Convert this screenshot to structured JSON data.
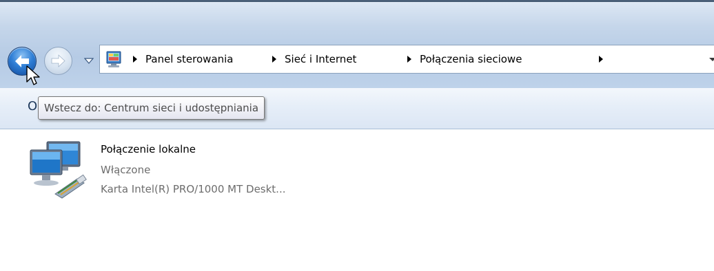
{
  "navigation": {
    "back_icon": "arrow-left-icon",
    "forward_icon": "arrow-right-icon",
    "history_icon": "chevron-down-icon"
  },
  "address_bar": {
    "icon": "control-panel-icon",
    "breadcrumbs": [
      "Panel sterowania",
      "Sieć i Internet",
      "Połączenia sieciowe"
    ],
    "dropdown_icon": "chevron-down-icon"
  },
  "tooltip": {
    "text": "Wstecz do: Centrum sieci i udostępniania"
  },
  "command_bar": {
    "partial_label": "O"
  },
  "connections": [
    {
      "name": "Połączenie lokalne",
      "status": "Włączone",
      "device": "Karta Intel(R) PRO/1000 MT Deskt...",
      "icon": "network-connection-icon"
    }
  ],
  "colors": {
    "titlebar": "#c5d6ea",
    "back_button": "#2f7fd6",
    "tooltip_border": "#767676",
    "secondary_text": "#6d6d6d"
  }
}
